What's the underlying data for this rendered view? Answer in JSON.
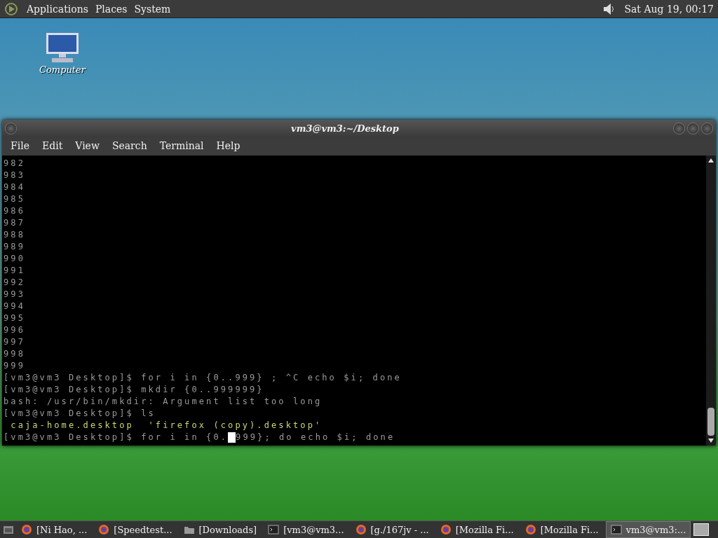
{
  "top_panel": {
    "menus": [
      "Applications",
      "Places",
      "System"
    ],
    "clock": "Sat Aug 19, 00:17"
  },
  "desktop_icons": [
    {
      "label": "Computer"
    }
  ],
  "window": {
    "title": "vm3@vm3:~/Desktop",
    "menu": [
      "File",
      "Edit",
      "View",
      "Search",
      "Terminal",
      "Help"
    ],
    "lines": [
      {
        "kind": "output",
        "text": "982"
      },
      {
        "kind": "output",
        "text": "983"
      },
      {
        "kind": "output",
        "text": "984"
      },
      {
        "kind": "output",
        "text": "985"
      },
      {
        "kind": "output",
        "text": "986"
      },
      {
        "kind": "output",
        "text": "987"
      },
      {
        "kind": "output",
        "text": "988"
      },
      {
        "kind": "output",
        "text": "989"
      },
      {
        "kind": "output",
        "text": "990"
      },
      {
        "kind": "output",
        "text": "991"
      },
      {
        "kind": "output",
        "text": "992"
      },
      {
        "kind": "output",
        "text": "993"
      },
      {
        "kind": "output",
        "text": "994"
      },
      {
        "kind": "output",
        "text": "995"
      },
      {
        "kind": "output",
        "text": "996"
      },
      {
        "kind": "output",
        "text": "997"
      },
      {
        "kind": "output",
        "text": "998"
      },
      {
        "kind": "output",
        "text": "999"
      },
      {
        "kind": "output",
        "text": "[vm3@vm3 Desktop]$ for i in {0..999} ; ^C echo $i; done"
      },
      {
        "kind": "output",
        "text": "[vm3@vm3 Desktop]$ mkdir {0..999999}"
      },
      {
        "kind": "output",
        "text": "bash: /usr/bin/mkdir: Argument list too long"
      },
      {
        "kind": "output",
        "text": "[vm3@vm3 Desktop]$ ls"
      },
      {
        "kind": "listing",
        "text": " caja-home.desktop  'firefox (copy).desktop'"
      },
      {
        "kind": "input",
        "before": "[vm3@vm3 Desktop]$ for i in {0.",
        "after": "999}; do echo $i; done"
      }
    ]
  },
  "taskbar": [
    {
      "label": "[Ni Hao, ...",
      "kind": "browser",
      "selected": false
    },
    {
      "label": "[Speedtest...",
      "kind": "browser",
      "selected": false
    },
    {
      "label": "[Downloads]",
      "kind": "folder",
      "selected": false
    },
    {
      "label": "[vm3@vm3...",
      "kind": "terminal",
      "selected": false
    },
    {
      "label": "[g./167jv - ...",
      "kind": "browser",
      "selected": false
    },
    {
      "label": "[Mozilla Fi...",
      "kind": "browser",
      "selected": false
    },
    {
      "label": "[Mozilla Fi...",
      "kind": "browser",
      "selected": false
    },
    {
      "label": "vm3@vm3:...",
      "kind": "terminal",
      "selected": true
    }
  ]
}
